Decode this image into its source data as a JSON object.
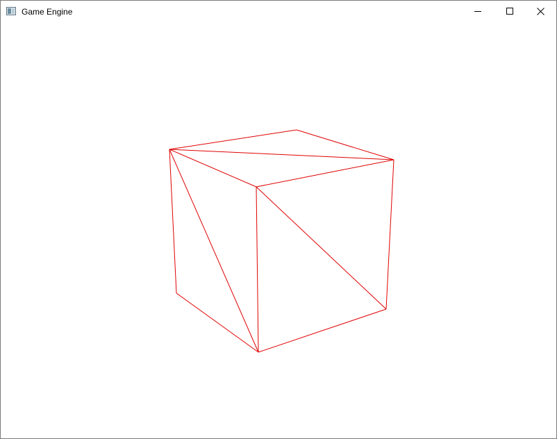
{
  "window": {
    "title": "Game Engine",
    "icon": "app-window-icon",
    "controls": [
      "minimize-icon",
      "maximize-icon",
      "close-icon"
    ]
  },
  "viewport": {
    "background": "#ffffff",
    "render_mode": "wireframe",
    "line_color": "#e00000",
    "object": "cube"
  }
}
